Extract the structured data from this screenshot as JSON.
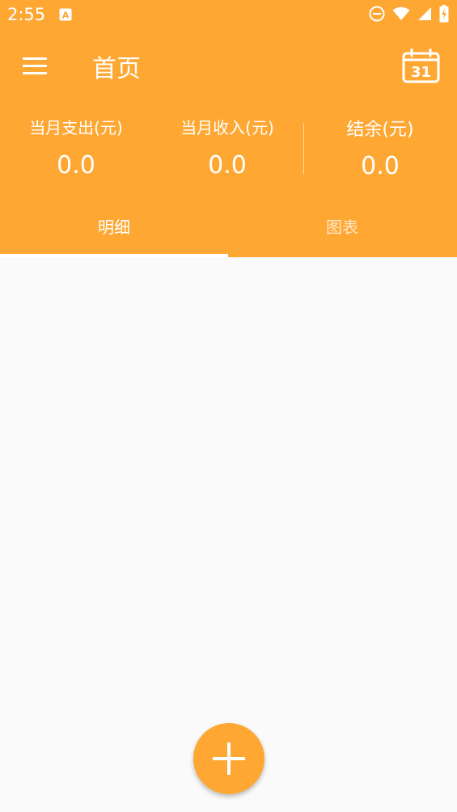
{
  "status_bar": {
    "time": "2:55",
    "icons": [
      "app-notification-icon",
      "do-not-disturb-icon",
      "wifi-icon",
      "cell-signal-icon",
      "battery-icon"
    ]
  },
  "toolbar": {
    "title": "首页",
    "menu_icon": "menu-icon",
    "calendar_icon": "calendar-icon",
    "calendar_day": "31"
  },
  "summary": {
    "expense": {
      "label": "当月支出(元)",
      "value": "0.0"
    },
    "income": {
      "label": "当月收入(元)",
      "value": "0.0"
    },
    "balance": {
      "label": "结余(元)",
      "value": "0.0"
    }
  },
  "tabs": [
    {
      "label": "明细",
      "selected": true
    },
    {
      "label": "图表",
      "selected": false
    }
  ],
  "fab": {
    "icon": "plus-icon"
  },
  "colors": {
    "primary": "#ffa733",
    "background": "#fafafa",
    "on_primary": "#ffffff"
  }
}
